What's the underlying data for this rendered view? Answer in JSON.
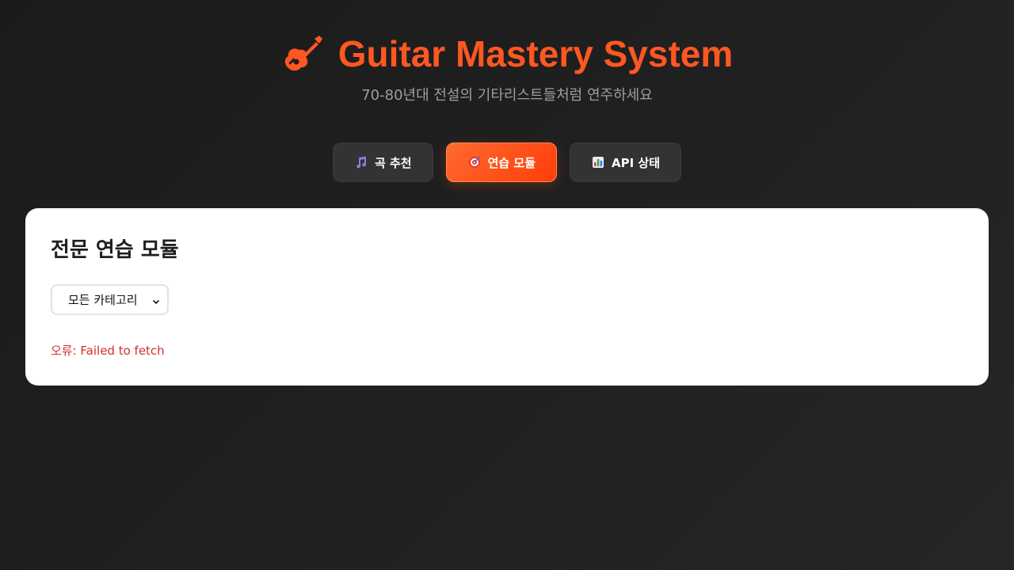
{
  "header": {
    "title": "Guitar Mastery System",
    "subtitle": "70-80년대 전설의 기타리스트들처럼 연주하세요",
    "icon": "guitar-icon"
  },
  "tabs": [
    {
      "label": "곡 추천",
      "icon": "music-note-icon",
      "active": false
    },
    {
      "label": "연습 모듈",
      "icon": "target-icon",
      "active": true
    },
    {
      "label": "API 상태",
      "icon": "bar-chart-icon",
      "active": false
    }
  ],
  "main": {
    "heading": "전문 연습 모듈",
    "category_select": {
      "selected": "모든 카테고리"
    },
    "error_text": "오류: Failed to fetch"
  },
  "colors": {
    "accent": "#ff5722",
    "error": "#d32f2f",
    "background": "#1f1f1f",
    "tab_bg": "#333333"
  }
}
